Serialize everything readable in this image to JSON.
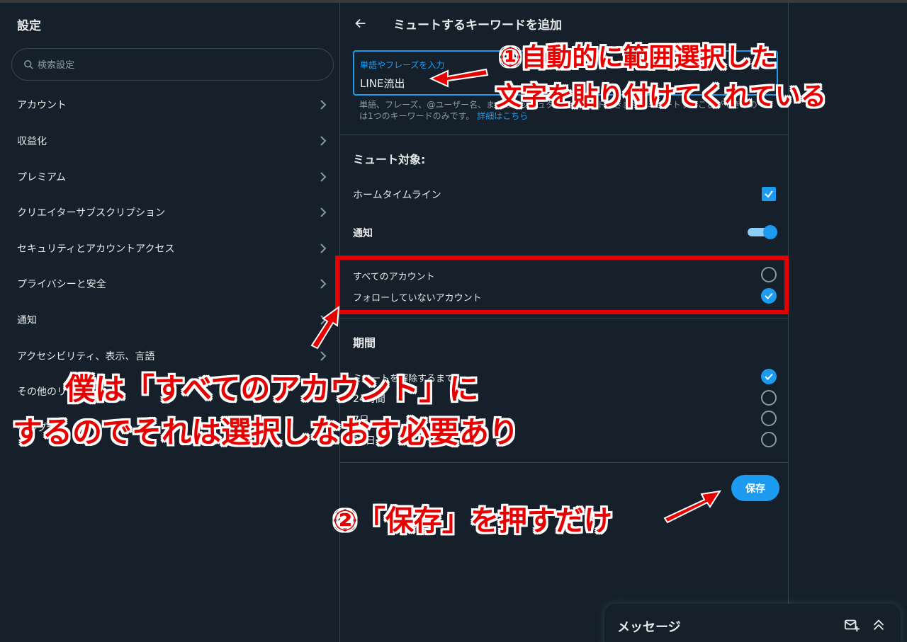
{
  "settings": {
    "title": "設定",
    "search_placeholder": "検索設定",
    "items": [
      {
        "label": "アカウント"
      },
      {
        "label": "収益化"
      },
      {
        "label": "プレミアム"
      },
      {
        "label": "クリエイターサブスクリプション"
      },
      {
        "label": "セキュリティとアカウントアクセス"
      },
      {
        "label": "プライバシーと安全"
      },
      {
        "label": "通知"
      },
      {
        "label": "アクセシビリティ、表示、言語"
      },
      {
        "label": "その他のリ"
      },
      {
        "label": "ヘルプセ"
      }
    ]
  },
  "mute": {
    "title": "ミュートするキーワードを追加",
    "keyword_label": "単語やフレーズを入力",
    "keyword_value": "LINE流出",
    "helper_text": "単語、フレーズ、@ユーザー名、またはハッシュタグをミュートできます。ミュートすることができるのは1つのキーワードのみです。",
    "helper_link": "詳細はこちら",
    "target_title": "ミュート対象:",
    "home_timeline": "ホームタイムライン",
    "notifications": "通知",
    "all_accounts": "すべてのアカウント",
    "non_followed": "フォローしていないアカウント",
    "duration_title": "期間",
    "durations": [
      {
        "label": "ミュートを解除するまで",
        "checked": true
      },
      {
        "label": "24時間",
        "checked": false
      },
      {
        "label": "7日",
        "checked": false
      },
      {
        "label": "30日",
        "checked": false
      }
    ],
    "save": "保存"
  },
  "messages": {
    "title": "メッセージ"
  },
  "annotations": {
    "note1_line1": "①自動的に範囲選択した",
    "note1_line2": "文字を貼り付けてくれている",
    "note2_line1": "僕は「すべてのアカウント」に",
    "note2_line2": "するのでそれは選択しなおす必要あり",
    "note3": "②「保存」を押すだけ",
    "color": "#e60000"
  },
  "colors": {
    "background": "#15202b",
    "accent": "#1d9bf0",
    "border": "#38444d",
    "secondary_text": "#8b98a5"
  }
}
